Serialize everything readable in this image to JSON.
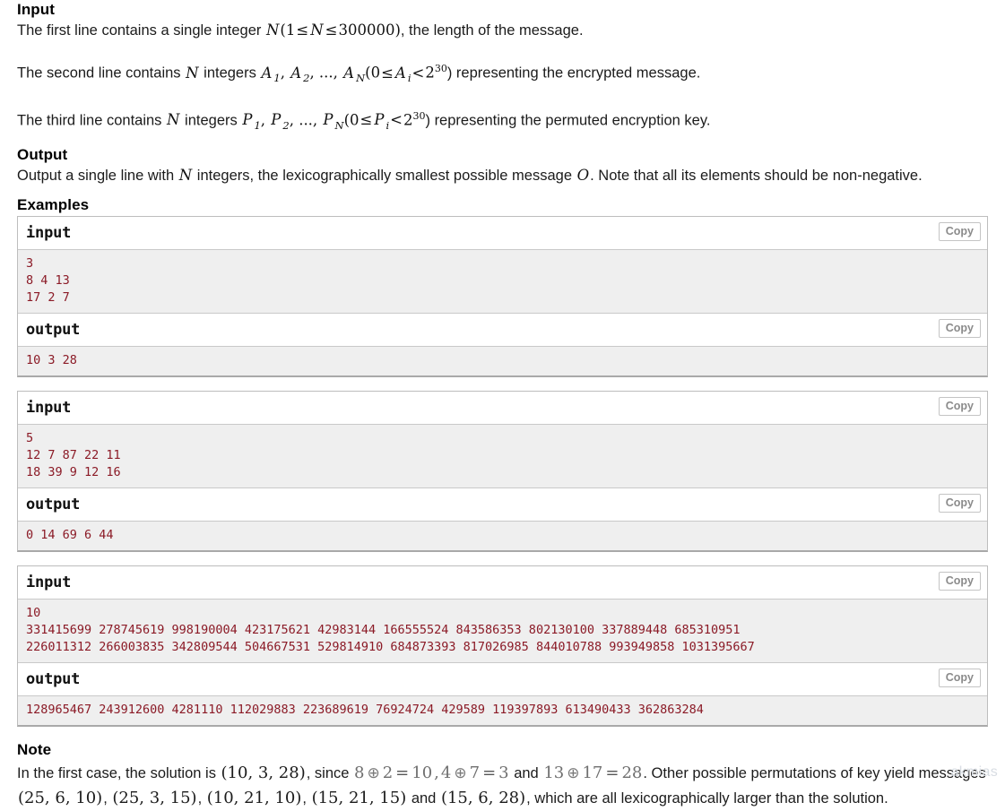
{
  "sections": {
    "input": {
      "heading": "Input",
      "lines": [
        {
          "prefix": "The first line contains a single integer ",
          "math_var": "N",
          "constraint_open": "(1",
          "le1": "≤",
          "var2": "N",
          "le2": "≤",
          "bound": "300000",
          "constraint_close": ")",
          "suffix": ", the length of the message."
        },
        {
          "prefix": "The second line contains ",
          "math_var": "N",
          "mid": " integers ",
          "arr": "A",
          "suffix": ") representing the encrypted message."
        },
        {
          "prefix": "The third line contains ",
          "math_var": "N",
          "mid": " integers ",
          "arr": "P",
          "suffix": ") representing the permuted encryption key."
        }
      ],
      "sub1": "1",
      "sub2": "2",
      "subN": "N",
      "subi": "i",
      "ellipsis": ", ..., ",
      "comma": ", ",
      "paren_open": "(0",
      "le": "≤",
      "lt": "<",
      "base": "2",
      "exp": "30"
    },
    "output": {
      "heading": "Output",
      "prefix": "Output a single line with ",
      "math_var": "N",
      "mid": " integers, the lexicographically smallest possible message ",
      "out_var": "O",
      "suffix": ". Note that all its elements should be non-negative."
    },
    "examples": {
      "heading": "Examples",
      "copy_label": "Copy",
      "input_label": "input",
      "output_label": "output",
      "groups": [
        {
          "input": "3\n8 4 13\n17 2 7",
          "output": "10 3 28"
        },
        {
          "input": "5\n12 7 87 22 11\n18 39 9 12 16",
          "output": "0 14 69 6 44"
        },
        {
          "input": "10\n331415699 278745619 998190004 423175621 42983144 166555524 843586353 802130100 337889448 685310951\n226011312 266003835 342809544 504667531 529814910 684873393 817026985 844010788 993949858 1031395667",
          "output": "128965467 243912600 4281110 112029883 223689619 76924724 429589 119397893 613490433 362863284"
        }
      ]
    },
    "note": {
      "heading": "Note",
      "t1": "In the first case, the solution is ",
      "sol": "(10, 3, 28)",
      "t2": ", since ",
      "eq1_a": "8",
      "xor": "⊕",
      "eq1_b": "2",
      "eq": "=",
      "eq1_c": "10",
      "t3": ",",
      "eq2_a": "4",
      "eq2_b": "7",
      "eq2_c": "3",
      "t4": " and ",
      "eq3_a": "13",
      "eq3_b": "17",
      "eq3_c": "28",
      "t5": ". Other possible permutations of key yield messages ",
      "p1": "(25, 6, 10)",
      "p2": "(25, 3, 15)",
      "p3": "(10, 21, 10)",
      "p4": "(15, 21, 15)",
      "t6": " and ",
      "p5": "(15, 6, 28)",
      "t7": ", which are all lexicographically larger than the solution.",
      "sep": ", "
    }
  },
  "watermark": {
    "text": "akmias"
  },
  "colors": {
    "code_text": "#8b1a26",
    "code_bg": "#efefef",
    "border": "#bdbdbd",
    "copy_text": "#8b8b8b",
    "heading": "#000000"
  }
}
